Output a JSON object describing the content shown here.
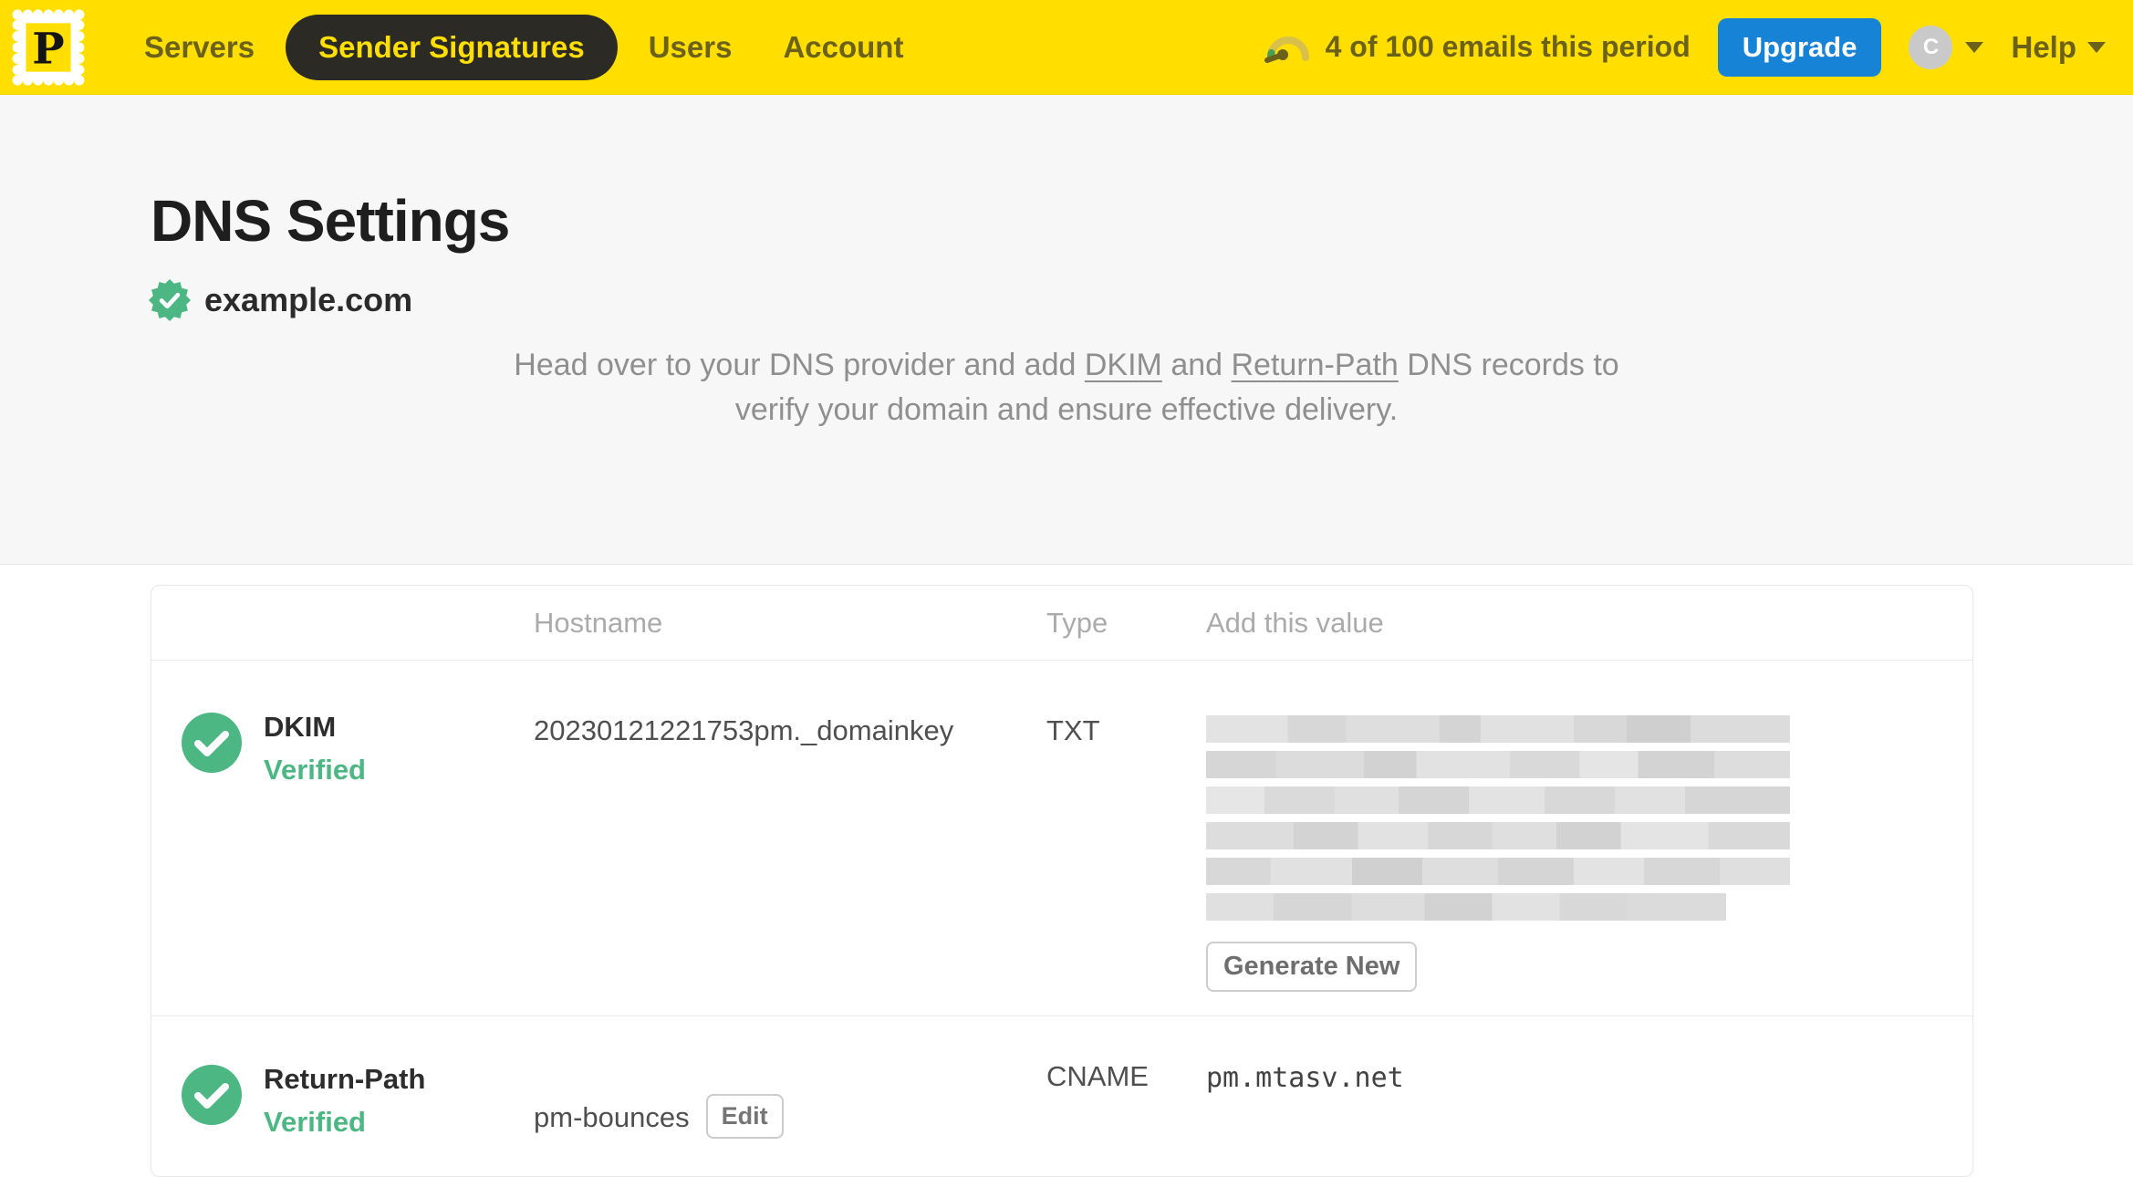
{
  "nav": {
    "logo_letter": "P",
    "items": [
      {
        "label": "Servers",
        "active": false
      },
      {
        "label": "Sender Signatures",
        "active": true
      },
      {
        "label": "Users",
        "active": false
      },
      {
        "label": "Account",
        "active": false
      }
    ],
    "usage_text": "4 of 100 emails this period",
    "upgrade_label": "Upgrade",
    "avatar_initial": "C",
    "help_label": "Help"
  },
  "page": {
    "title": "DNS Settings",
    "domain": "example.com",
    "domain_status": "verified",
    "description": {
      "part1": "Head over to your DNS provider and add ",
      "link_dkim": "DKIM",
      "part2": " and ",
      "link_return_path": "Return-Path",
      "part3": " DNS records to",
      "line2": "verify your domain and ensure effective delivery."
    }
  },
  "table": {
    "headers": [
      "Hostname",
      "Type",
      "Add this value"
    ],
    "rows": [
      {
        "name": "DKIM",
        "status": "Verified",
        "hostname": "20230121221753pm._domainkey",
        "type": "TXT",
        "value_redacted": true,
        "redacted_lines": 6,
        "action_label": "Generate New"
      },
      {
        "name": "Return-Path",
        "status": "Verified",
        "hostname": "pm-bounces",
        "edit_label": "Edit",
        "type": "CNAME",
        "value": "pm.mtasv.net"
      }
    ]
  },
  "colors": {
    "brand_yellow": "#FFDE00",
    "nav_text": "#6C6118",
    "active_pill_bg": "#2B2A24",
    "upgrade_blue": "#1783D6",
    "verified_green": "#4CB782",
    "page_bg_top": "#F7F7F8",
    "card_border": "#E8E8E8"
  }
}
